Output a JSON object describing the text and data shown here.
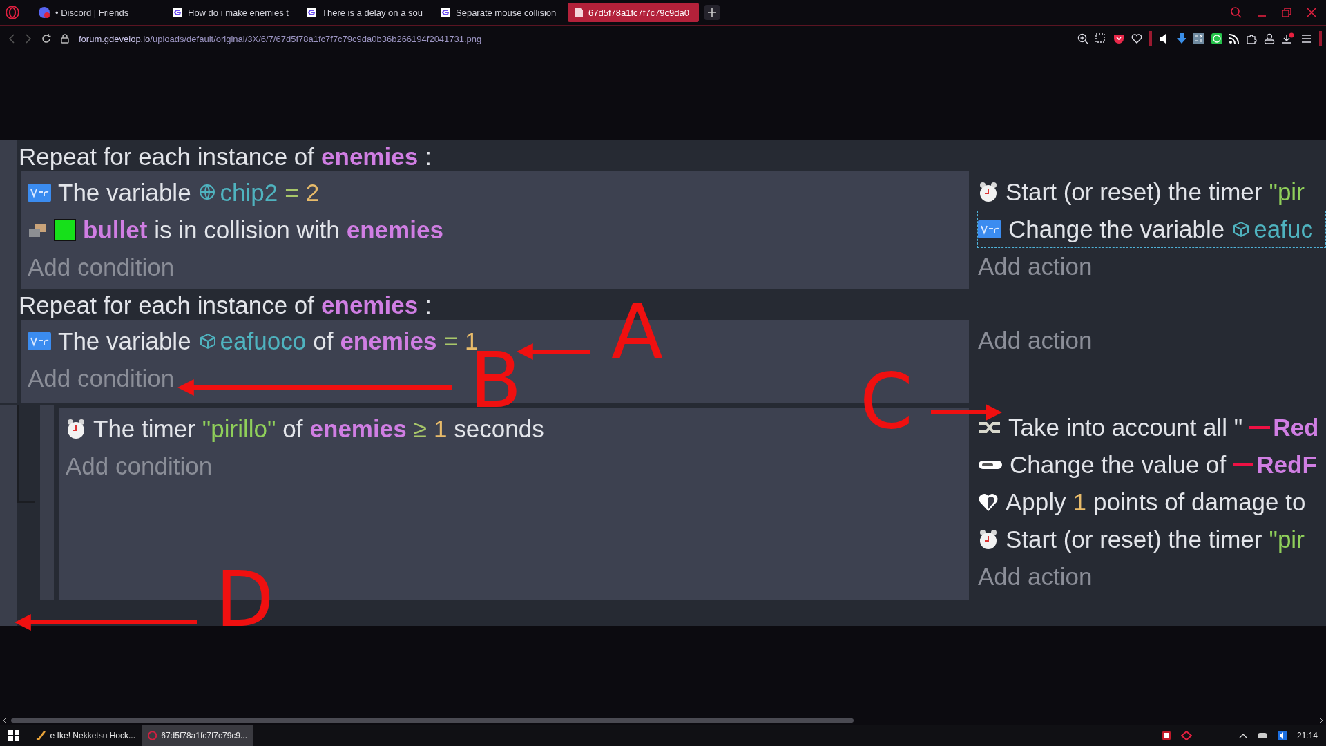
{
  "tabs": [
    {
      "label": "• Discord | Friends",
      "kind": "discord",
      "selected": false
    },
    {
      "label": "How do i make enemies t",
      "kind": "gdevelop",
      "selected": false
    },
    {
      "label": "There is a delay on a sou",
      "kind": "gdevelop",
      "selected": false
    },
    {
      "label": "Separate mouse collision",
      "kind": "gdevelop",
      "selected": false
    },
    {
      "label": "67d5f78a1fc7f7c79c9da0",
      "kind": "file",
      "selected": true
    }
  ],
  "address_bar": {
    "host": "forum.gdevelop.io",
    "path": "/uploads/default/original/3X/6/7/67d5f78a1fc7f7c79c9da0b36b266194f2041731.png"
  },
  "events": [
    {
      "kind": "foreach",
      "header": [
        {
          "kind": "text",
          "text": "Repeat for each instance of"
        },
        {
          "kind": "object",
          "text": "enemies"
        },
        {
          "kind": "text",
          "text": ":"
        }
      ],
      "conditions": [
        {
          "kind": "var",
          "parts": [
            {
              "kind": "text",
              "text": "The variable"
            },
            {
              "kind": "global-var",
              "text": "chip2"
            },
            {
              "kind": "operator",
              "text": "="
            },
            {
              "kind": "number",
              "text": "2"
            }
          ]
        },
        {
          "kind": "collision",
          "parts": [
            {
              "kind": "square"
            },
            {
              "kind": "object",
              "text": "bullet"
            },
            {
              "kind": "text",
              "text": "is in collision with"
            },
            {
              "kind": "object",
              "text": "enemies"
            }
          ]
        }
      ],
      "add_condition": "Add condition",
      "actions": [
        {
          "kind": "timer",
          "selected": false,
          "parts": [
            {
              "kind": "text",
              "text": "Start (or reset) the timer"
            },
            {
              "kind": "string",
              "text": "\"pir"
            }
          ]
        },
        {
          "kind": "var",
          "selected": true,
          "parts": [
            {
              "kind": "text",
              "text": "Change the variable"
            },
            {
              "kind": "object-var",
              "text": "eafuc"
            }
          ]
        }
      ],
      "add_action": "Add action"
    },
    {
      "kind": "foreach",
      "header": [
        {
          "kind": "text",
          "text": "Repeat for each instance of"
        },
        {
          "kind": "object",
          "text": "enemies"
        },
        {
          "kind": "text",
          "text": ":"
        }
      ],
      "conditions": [
        {
          "kind": "var",
          "parts": [
            {
              "kind": "text",
              "text": "The variable"
            },
            {
              "kind": "object-var",
              "text": "eafuoco"
            },
            {
              "kind": "text",
              "text": "of"
            },
            {
              "kind": "object",
              "text": "enemies"
            },
            {
              "kind": "operator",
              "text": "="
            },
            {
              "kind": "number",
              "text": "1"
            }
          ]
        }
      ],
      "add_condition": "Add condition",
      "add_action": "Add action"
    },
    {
      "kind": "sub",
      "conditions": [
        {
          "kind": "timer",
          "parts": [
            {
              "kind": "text",
              "text": "The timer"
            },
            {
              "kind": "string",
              "text": "\"pirillo\""
            },
            {
              "kind": "text",
              "text": "of"
            },
            {
              "kind": "object",
              "text": "enemies"
            },
            {
              "kind": "operator",
              "text": "≥"
            },
            {
              "kind": "number",
              "text": "1"
            },
            {
              "kind": "text",
              "text": "seconds"
            }
          ]
        }
      ],
      "add_condition": "Add condition",
      "actions": [
        {
          "kind": "link",
          "selected": false,
          "parts": [
            {
              "kind": "text",
              "text": "Take into account all \""
            },
            {
              "kind": "line"
            },
            {
              "kind": "object",
              "text": "Red"
            }
          ]
        },
        {
          "kind": "toggle",
          "selected": false,
          "parts": [
            {
              "kind": "text",
              "text": "Change the value of"
            },
            {
              "kind": "line"
            },
            {
              "kind": "object",
              "text": "RedF"
            }
          ]
        },
        {
          "kind": "heart",
          "selected": false,
          "parts": [
            {
              "kind": "text",
              "text": "Apply"
            },
            {
              "kind": "number",
              "text": "1"
            },
            {
              "kind": "text",
              "text": "points of damage to"
            }
          ]
        },
        {
          "kind": "timer",
          "selected": false,
          "parts": [
            {
              "kind": "text",
              "text": "Start (or reset) the timer"
            },
            {
              "kind": "string",
              "text": "\"pir"
            }
          ]
        }
      ],
      "add_action": "Add action"
    }
  ],
  "annotations": [
    {
      "label": "A"
    },
    {
      "label": "B"
    },
    {
      "label": "C"
    },
    {
      "label": "D"
    }
  ],
  "taskbar": {
    "tasks": [
      {
        "label": "e Ike! Nekketsu Hock...",
        "selected": false
      },
      {
        "label": "67d5f78a1fc7f7c79c9...",
        "selected": true
      }
    ],
    "time": "21:14"
  }
}
